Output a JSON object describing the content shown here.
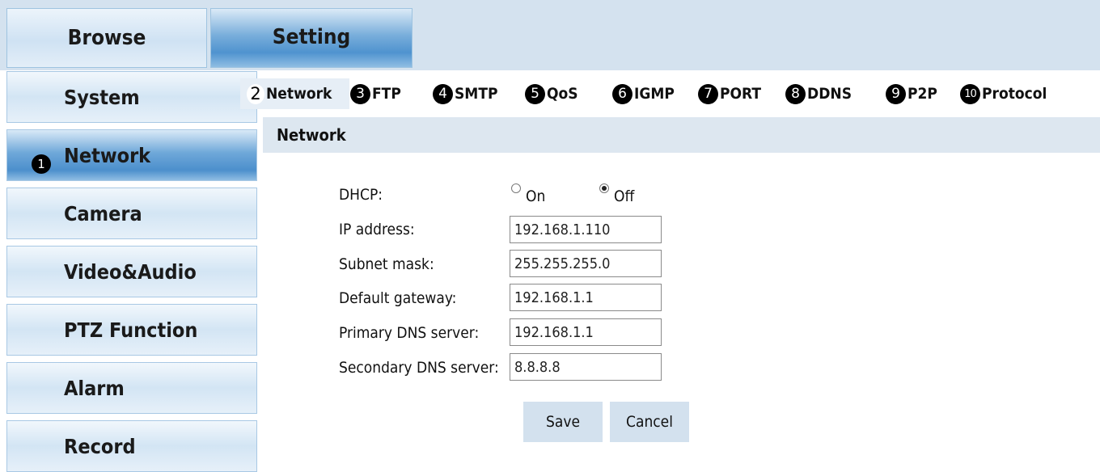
{
  "top_tabs": {
    "browse": "Browse",
    "setting": "Setting"
  },
  "sidebar": {
    "items": [
      {
        "label": "System"
      },
      {
        "label": "Network",
        "marker": "❶",
        "active": true
      },
      {
        "label": "Camera"
      },
      {
        "label": "Video&Audio"
      },
      {
        "label": "PTZ Function"
      },
      {
        "label": "Alarm"
      },
      {
        "label": "Record"
      }
    ]
  },
  "tabs": [
    {
      "marker": "2",
      "label": "Network",
      "active": true
    },
    {
      "marker": "3",
      "label": "FTP"
    },
    {
      "marker": "4",
      "label": "SMTP"
    },
    {
      "marker": "5",
      "label": "QoS"
    },
    {
      "marker": "6",
      "label": "IGMP"
    },
    {
      "marker": "7",
      "label": "PORT"
    },
    {
      "marker": "8",
      "label": "DDNS"
    },
    {
      "marker": "9",
      "label": "P2P"
    },
    {
      "marker": "10",
      "label": "Protocol"
    }
  ],
  "panel": {
    "title": "Network",
    "dhcp": {
      "label": "DHCP:",
      "on": "On",
      "off": "Off",
      "selected": "Off"
    },
    "fields": [
      {
        "label": "IP address:",
        "value": "192.168.1.110"
      },
      {
        "label": "Subnet mask:",
        "value": "255.255.255.0"
      },
      {
        "label": "Default gateway:",
        "value": "192.168.1.1"
      },
      {
        "label": "Primary DNS server:",
        "value": "192.168.1.1"
      },
      {
        "label": "Secondary DNS server:",
        "value": "8.8.8.8"
      }
    ],
    "buttons": {
      "save": "Save",
      "cancel": "Cancel"
    }
  },
  "colors": {
    "accent_blue": "#4f93cf",
    "tab_bar_bg": "#d4e2ef",
    "panel_header_bg": "#dde7f0",
    "button_bg": "#d3e1ee"
  }
}
